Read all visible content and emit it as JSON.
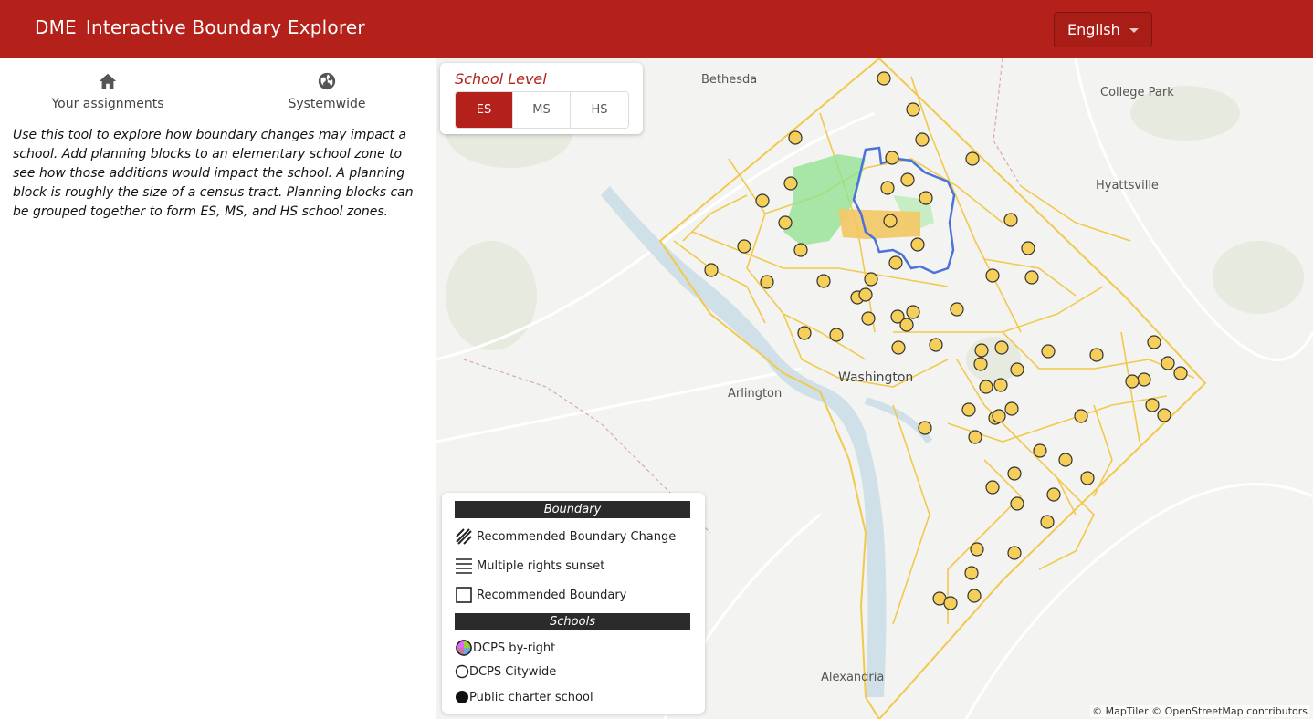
{
  "header": {
    "brand_short": "DME",
    "title": "Interactive Boundary Explorer",
    "language": "English"
  },
  "sidebar": {
    "tabs": [
      {
        "label": "Your assignments",
        "icon": "home-icon"
      },
      {
        "label": "Systemwide",
        "icon": "globe-icon"
      }
    ],
    "intro": "Use this tool to explore how boundary changes may impact a school. Add planning blocks to an elementary school zone to see how those additions would impact the school. A planning block is roughly the size of a census tract. Planning blocks can be grouped together to form ES, MS, and HS school zones."
  },
  "map": {
    "places": {
      "bethesda": "Bethesda",
      "college_park": "College Park",
      "hyattsville": "Hyattsville",
      "washington": "Washington",
      "arlington": "Arlington",
      "alexandria": "Alexandria"
    },
    "school_level": {
      "title": "School Level",
      "options": [
        "ES",
        "MS",
        "HS"
      ],
      "selected": "ES"
    },
    "legend": {
      "boundary_header": "Boundary",
      "boundary_items": [
        "Recommended Boundary Change",
        "Multiple rights sunset",
        "Recommended Boundary"
      ],
      "schools_header": "Schools",
      "school_items": [
        "DCPS by-right",
        "DCPS Citywide",
        "Public charter school"
      ]
    },
    "attribution": "© MapTiler © OpenStreetMap contributors",
    "colors": {
      "header": "#b3211a",
      "school_marker": "#f6cf5a",
      "zone_line": "#f2c94c",
      "selected_zone": "#4a72d9",
      "added_blocks": "#8fe28f",
      "current_zone_fill": "#f3c863"
    }
  }
}
